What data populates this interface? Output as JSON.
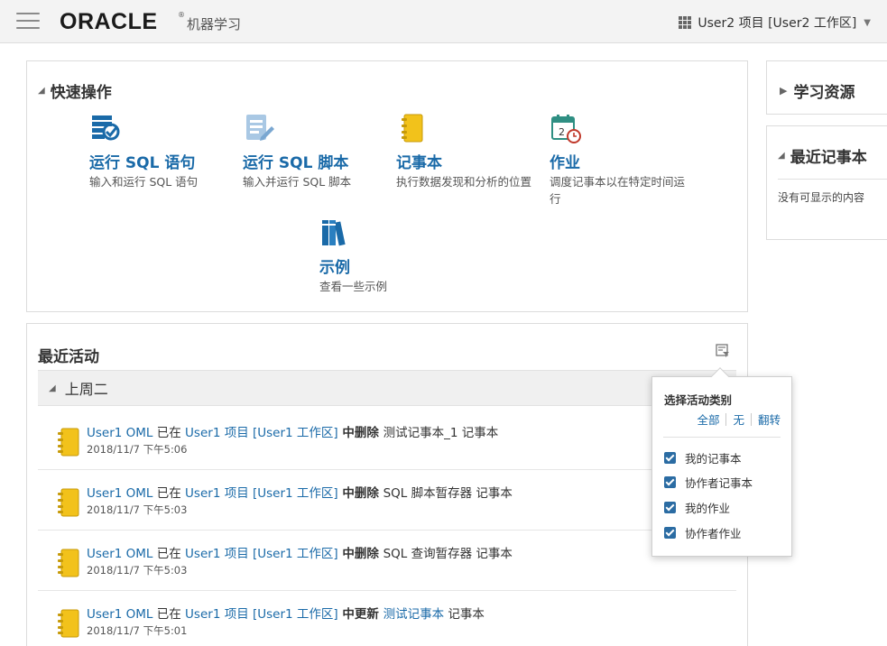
{
  "header": {
    "logo": "ORACLE",
    "logo_mark": "®",
    "app_name": "机器学习",
    "project": "User2 项目 [User2 工作区]"
  },
  "quick_actions": {
    "title": "快速操作",
    "items": [
      {
        "title": "运行 SQL 语句",
        "desc": "输入和运行 SQL 语句",
        "icon": "sql-statement-icon"
      },
      {
        "title": "运行 SQL 脚本",
        "desc": "输入并运行 SQL 脚本",
        "icon": "sql-script-icon"
      },
      {
        "title": "记事本",
        "desc": "执行数据发现和分析的位置",
        "icon": "notebook-icon"
      },
      {
        "title": "作业",
        "desc": "调度记事本以在特定时间运行",
        "icon": "calendar-clock-icon"
      },
      {
        "title": "示例",
        "desc": "查看一些示例",
        "icon": "books-icon"
      }
    ]
  },
  "recent": {
    "title": "最近活动",
    "group": "上周二",
    "activities": [
      {
        "user": "User1 OML",
        "at": " 已在 ",
        "project": "User1 项目 [User1 工作区]",
        "action": " 中删除 ",
        "object": "测试记事本_1",
        "object_link": false,
        "suffix": " 记事本",
        "time": "2018/11/7 下午5:06"
      },
      {
        "user": "User1 OML",
        "at": " 已在 ",
        "project": "User1 项目 [User1 工作区]",
        "action": " 中删除 ",
        "object": "SQL 脚本暂存器",
        "object_link": false,
        "suffix": " 记事本",
        "time": "2018/11/7 下午5:03"
      },
      {
        "user": "User1 OML",
        "at": " 已在 ",
        "project": "User1 项目 [User1 工作区]",
        "action": " 中删除 ",
        "object": "SQL 查询暂存器",
        "object_link": false,
        "suffix": " 记事本",
        "time": "2018/11/7 下午5:03"
      },
      {
        "user": "User1 OML",
        "at": " 已在 ",
        "project": "User1 项目 [User1 工作区]",
        "action": " 中更新 ",
        "object": "测试记事本",
        "object_link": true,
        "suffix": " 记事本",
        "time": "2018/11/7 下午5:01"
      }
    ]
  },
  "filter_popup": {
    "title": "选择活动类别",
    "links": [
      "全部",
      "无",
      "翻转"
    ],
    "options": [
      {
        "label": "我的记事本",
        "checked": true
      },
      {
        "label": "协作者记事本",
        "checked": true
      },
      {
        "label": "我的作业",
        "checked": true
      },
      {
        "label": "协作者作业",
        "checked": true
      }
    ]
  },
  "sidebar": {
    "resources_title": "学习资源",
    "recent_notes_title": "最近记事本",
    "empty_text": "没有可显示的内容"
  },
  "colors": {
    "accent": "#1a6aa8",
    "notebook_yellow": "#f2c21b",
    "checkbox_blue": "#2b6ca3"
  }
}
